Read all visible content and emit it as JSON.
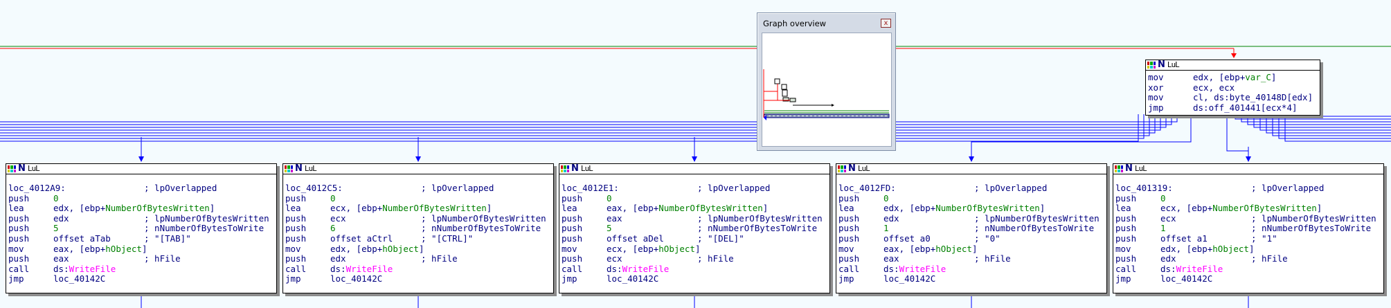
{
  "colors": {
    "background": "#f4fbfe",
    "edge_blue": "#0000ff",
    "edge_green": "#008000",
    "edge_red": "#ff0000",
    "mnemonic": "#000080",
    "immediate": "#008000",
    "import": "#ff00ff",
    "string_comment": "#808080"
  },
  "icons": {
    "node_header": [
      "color-grid-icon",
      "n-icon",
      "graph-icon"
    ]
  },
  "header_glyphs": {
    "n": "N",
    "ul": "LuL"
  },
  "overview": {
    "title": "Graph overview",
    "close_label": "x"
  },
  "dispatch_block": {
    "lines": [
      {
        "mn": "mov",
        "parts": [
          {
            "t": "edx, [ebp+",
            "c": "op"
          },
          {
            "t": "var_C",
            "c": "var"
          },
          {
            "t": "]",
            "c": "op"
          }
        ]
      },
      {
        "mn": "xor",
        "parts": [
          {
            "t": "ecx, ecx",
            "c": "op"
          }
        ]
      },
      {
        "mn": "mov",
        "parts": [
          {
            "t": "cl, ds:byte_40148D[edx]",
            "c": "op"
          }
        ]
      },
      {
        "mn": "jmp",
        "parts": [
          {
            "t": "ds:off_401441[ecx*4]",
            "c": "op"
          }
        ]
      }
    ]
  },
  "case_blocks": [
    {
      "label": "loc_4012A9:",
      "label_comment": "; lpOverlapped",
      "lines": [
        {
          "mn": "push",
          "parts": [
            {
              "t": "0",
              "c": "num"
            }
          ]
        },
        {
          "mn": "lea",
          "parts": [
            {
              "t": "edx, [ebp+",
              "c": "op"
            },
            {
              "t": "NumberOfBytesWritten",
              "c": "var"
            },
            {
              "t": "]",
              "c": "op"
            }
          ]
        },
        {
          "mn": "push",
          "parts": [
            {
              "t": "edx",
              "c": "op"
            }
          ],
          "comment": "; lpNumberOfBytesWritten"
        },
        {
          "mn": "push",
          "parts": [
            {
              "t": "5",
              "c": "num"
            }
          ],
          "comment": "; nNumberOfBytesToWrite"
        },
        {
          "mn": "push",
          "parts": [
            {
              "t": "offset aTab",
              "c": "op"
            }
          ],
          "comment": "; \"[TAB]\"",
          "comment_class": "str"
        },
        {
          "mn": "mov",
          "parts": [
            {
              "t": "eax, [ebp+",
              "c": "op"
            },
            {
              "t": "hObject",
              "c": "var"
            },
            {
              "t": "]",
              "c": "op"
            }
          ]
        },
        {
          "mn": "push",
          "parts": [
            {
              "t": "eax",
              "c": "op"
            }
          ],
          "comment": "; hFile"
        },
        {
          "mn": "call",
          "parts": [
            {
              "t": "ds:",
              "c": "op"
            },
            {
              "t": "WriteFile",
              "c": "fn"
            }
          ]
        },
        {
          "mn": "jmp",
          "parts": [
            {
              "t": "loc_40142C",
              "c": "op"
            }
          ]
        }
      ]
    },
    {
      "label": "loc_4012C5:",
      "label_comment": "; lpOverlapped",
      "lines": [
        {
          "mn": "push",
          "parts": [
            {
              "t": "0",
              "c": "num"
            }
          ]
        },
        {
          "mn": "lea",
          "parts": [
            {
              "t": "ecx, [ebp+",
              "c": "op"
            },
            {
              "t": "NumberOfBytesWritten",
              "c": "var"
            },
            {
              "t": "]",
              "c": "op"
            }
          ]
        },
        {
          "mn": "push",
          "parts": [
            {
              "t": "ecx",
              "c": "op"
            }
          ],
          "comment": "; lpNumberOfBytesWritten"
        },
        {
          "mn": "push",
          "parts": [
            {
              "t": "6",
              "c": "num"
            }
          ],
          "comment": "; nNumberOfBytesToWrite"
        },
        {
          "mn": "push",
          "parts": [
            {
              "t": "offset aCtrl",
              "c": "op"
            }
          ],
          "comment": "; \"[CTRL]\"",
          "comment_class": "str"
        },
        {
          "mn": "mov",
          "parts": [
            {
              "t": "edx, [ebp+",
              "c": "op"
            },
            {
              "t": "hObject",
              "c": "var"
            },
            {
              "t": "]",
              "c": "op"
            }
          ]
        },
        {
          "mn": "push",
          "parts": [
            {
              "t": "edx",
              "c": "op"
            }
          ],
          "comment": "; hFile"
        },
        {
          "mn": "call",
          "parts": [
            {
              "t": "ds:",
              "c": "op"
            },
            {
              "t": "WriteFile",
              "c": "fn"
            }
          ]
        },
        {
          "mn": "jmp",
          "parts": [
            {
              "t": "loc_40142C",
              "c": "op"
            }
          ]
        }
      ]
    },
    {
      "label": "loc_4012E1:",
      "label_comment": "; lpOverlapped",
      "lines": [
        {
          "mn": "push",
          "parts": [
            {
              "t": "0",
              "c": "num"
            }
          ]
        },
        {
          "mn": "lea",
          "parts": [
            {
              "t": "eax, [ebp+",
              "c": "op"
            },
            {
              "t": "NumberOfBytesWritten",
              "c": "var"
            },
            {
              "t": "]",
              "c": "op"
            }
          ]
        },
        {
          "mn": "push",
          "parts": [
            {
              "t": "eax",
              "c": "op"
            }
          ],
          "comment": "; lpNumberOfBytesWritten"
        },
        {
          "mn": "push",
          "parts": [
            {
              "t": "5",
              "c": "num"
            }
          ],
          "comment": "; nNumberOfBytesToWrite"
        },
        {
          "mn": "push",
          "parts": [
            {
              "t": "offset aDel",
              "c": "op"
            }
          ],
          "comment": "; \"[DEL]\"",
          "comment_class": "str"
        },
        {
          "mn": "mov",
          "parts": [
            {
              "t": "ecx, [ebp+",
              "c": "op"
            },
            {
              "t": "hObject",
              "c": "var"
            },
            {
              "t": "]",
              "c": "op"
            }
          ]
        },
        {
          "mn": "push",
          "parts": [
            {
              "t": "ecx",
              "c": "op"
            }
          ],
          "comment": "; hFile"
        },
        {
          "mn": "call",
          "parts": [
            {
              "t": "ds:",
              "c": "op"
            },
            {
              "t": "WriteFile",
              "c": "fn"
            }
          ]
        },
        {
          "mn": "jmp",
          "parts": [
            {
              "t": "loc_40142C",
              "c": "op"
            }
          ]
        }
      ]
    },
    {
      "label": "loc_4012FD:",
      "label_comment": "; lpOverlapped",
      "lines": [
        {
          "mn": "push",
          "parts": [
            {
              "t": "0",
              "c": "num"
            }
          ]
        },
        {
          "mn": "lea",
          "parts": [
            {
              "t": "edx, [ebp+",
              "c": "op"
            },
            {
              "t": "NumberOfBytesWritten",
              "c": "var"
            },
            {
              "t": "]",
              "c": "op"
            }
          ]
        },
        {
          "mn": "push",
          "parts": [
            {
              "t": "edx",
              "c": "op"
            }
          ],
          "comment": "; lpNumberOfBytesWritten"
        },
        {
          "mn": "push",
          "parts": [
            {
              "t": "1",
              "c": "num"
            }
          ],
          "comment": "; nNumberOfBytesToWrite"
        },
        {
          "mn": "push",
          "parts": [
            {
              "t": "offset a0",
              "c": "op"
            }
          ],
          "comment": "; \"0\"",
          "comment_class": "str"
        },
        {
          "mn": "mov",
          "parts": [
            {
              "t": "eax, [ebp+",
              "c": "op"
            },
            {
              "t": "hObject",
              "c": "var"
            },
            {
              "t": "]",
              "c": "op"
            }
          ]
        },
        {
          "mn": "push",
          "parts": [
            {
              "t": "eax",
              "c": "op"
            }
          ],
          "comment": "; hFile"
        },
        {
          "mn": "call",
          "parts": [
            {
              "t": "ds:",
              "c": "op"
            },
            {
              "t": "WriteFile",
              "c": "fn"
            }
          ]
        },
        {
          "mn": "jmp",
          "parts": [
            {
              "t": "loc_40142C",
              "c": "op"
            }
          ]
        }
      ]
    },
    {
      "label": "loc_401319:",
      "label_comment": "; lpOverlapped",
      "lines": [
        {
          "mn": "push",
          "parts": [
            {
              "t": "0",
              "c": "num"
            }
          ]
        },
        {
          "mn": "lea",
          "parts": [
            {
              "t": "ecx, [ebp+",
              "c": "op"
            },
            {
              "t": "NumberOfBytesWritten",
              "c": "var"
            },
            {
              "t": "]",
              "c": "op"
            }
          ]
        },
        {
          "mn": "push",
          "parts": [
            {
              "t": "ecx",
              "c": "op"
            }
          ],
          "comment": "; lpNumberOfBytesWritten"
        },
        {
          "mn": "push",
          "parts": [
            {
              "t": "1",
              "c": "num"
            }
          ],
          "comment": "; nNumberOfBytesToWrite"
        },
        {
          "mn": "push",
          "parts": [
            {
              "t": "offset a1",
              "c": "op"
            }
          ],
          "comment": "; \"1\"",
          "comment_class": "str"
        },
        {
          "mn": "mov",
          "parts": [
            {
              "t": "edx, [ebp+",
              "c": "op"
            },
            {
              "t": "hObject",
              "c": "var"
            },
            {
              "t": "]",
              "c": "op"
            }
          ]
        },
        {
          "mn": "push",
          "parts": [
            {
              "t": "edx",
              "c": "op"
            }
          ],
          "comment": "; hFile"
        },
        {
          "mn": "call",
          "parts": [
            {
              "t": "ds:",
              "c": "op"
            },
            {
              "t": "WriteFile",
              "c": "fn"
            }
          ]
        },
        {
          "mn": "jmp",
          "parts": [
            {
              "t": "loc_40142C",
              "c": "op"
            }
          ]
        }
      ]
    }
  ]
}
